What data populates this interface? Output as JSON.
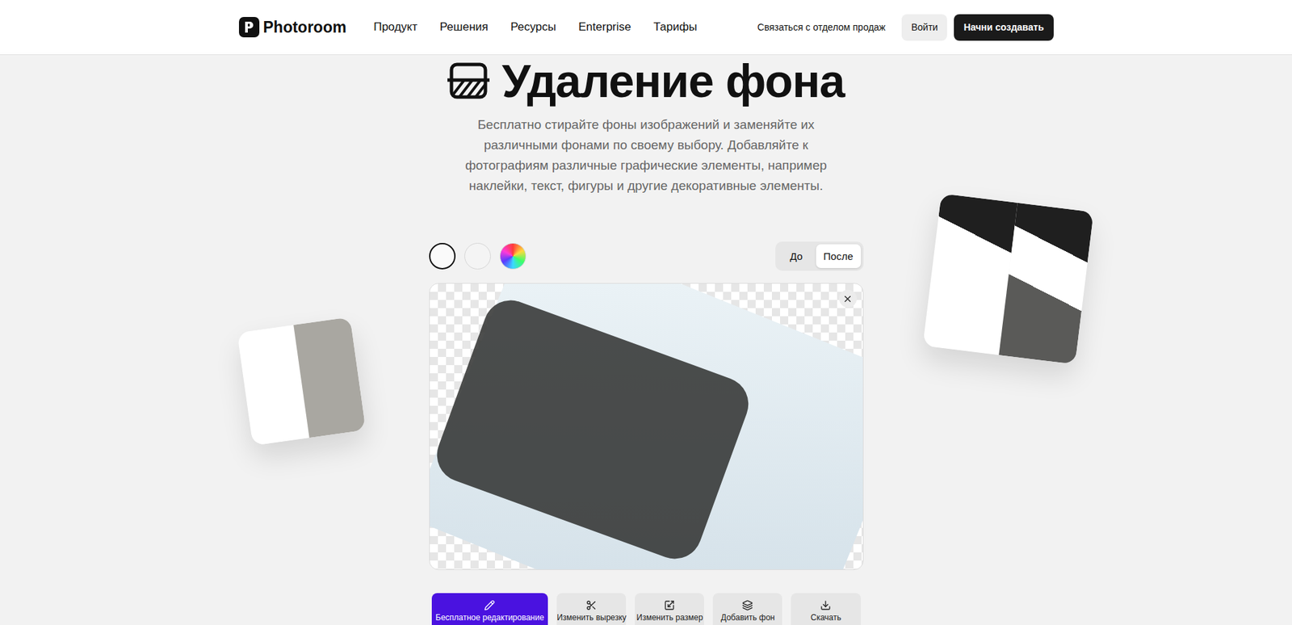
{
  "header": {
    "logo": "Photoroom",
    "nav": [
      "Продукт",
      "Решения",
      "Ресурсы",
      "Enterprise",
      "Тарифы"
    ],
    "contact": "Связаться с отделом продаж",
    "login": "Войти",
    "cta": "Начни создавать"
  },
  "hero": {
    "title": "Удаление фона",
    "subtitle": "Бесплатно стирайте фоны изображений и заменяйте их различными фонами по своему выбору. Добавляйте к фотографиям различные графические элементы, например наклейки, текст, фигуры и другие декоративные элементы."
  },
  "swatches": [
    {
      "kind": "transparent",
      "selected": true
    },
    {
      "kind": "solid",
      "selected": false,
      "color": "#f4f4f4"
    },
    {
      "kind": "picker",
      "selected": false
    }
  ],
  "view_toggle": [
    {
      "label": "До",
      "selected": false
    },
    {
      "label": "После",
      "selected": true
    }
  ],
  "toolbar": [
    {
      "label": "Бесплатное редактирование",
      "kind": "edit",
      "selected": true
    },
    {
      "label": "Изменить вырезку",
      "kind": "cutout",
      "selected": false
    },
    {
      "label": "Изменить размер",
      "kind": "resize",
      "selected": false
    },
    {
      "label": "Добавить фон",
      "kind": "background",
      "selected": false
    },
    {
      "label": "Скачать",
      "kind": "download",
      "selected": false
    }
  ]
}
